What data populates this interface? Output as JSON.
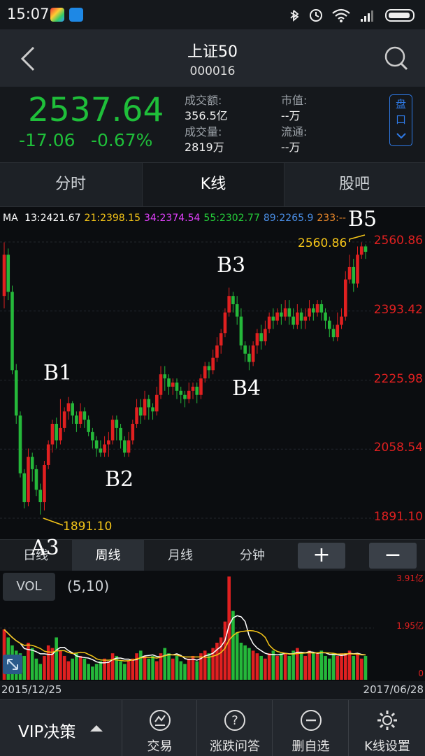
{
  "status_bar": {
    "time": "15:07",
    "battery_icon": "battery-icon",
    "wifi_icon": "wifi-icon"
  },
  "nav": {
    "title": "上证50",
    "code": "000016",
    "back_icon": "back-icon",
    "search_icon": "search-icon"
  },
  "quote": {
    "price": "2537.64",
    "change": "-17.06",
    "change_pct": "-0.67%",
    "turnover_label": "成交额:",
    "turnover_value": "356.5亿",
    "volume_label": "成交量:",
    "volume_value": "2819万",
    "market_cap_label": "市值:",
    "market_cap_value": "--万",
    "float_label": "流通:",
    "float_value": "--万",
    "pan_button": "盘\n口"
  },
  "tabs": [
    {
      "label": "分时"
    },
    {
      "label": "K线"
    },
    {
      "label": "股吧"
    }
  ],
  "ma": {
    "label": "MA",
    "items": [
      {
        "text": "13:2421.67",
        "color": "#ffffff"
      },
      {
        "text": "21:2398.15",
        "color": "#f5c518"
      },
      {
        "text": "34:2374.54",
        "color": "#e040fb"
      },
      {
        "text": "55:2302.77",
        "color": "#25d03a"
      },
      {
        "text": "89:2265.9",
        "color": "#4a8fe7"
      },
      {
        "text": "233:--",
        "color": "#e8872a"
      }
    ]
  },
  "chart_data": {
    "type": "candlestick",
    "y_ticks": [
      "2560.86",
      "2393.42",
      "2225.98",
      "2058.54",
      "1891.10"
    ],
    "ylim": [
      1891.1,
      2560.86
    ],
    "high_marker": "2560.86",
    "low_marker": "1891.10",
    "annotations": [
      "B1",
      "B2",
      "B3",
      "B4",
      "B5",
      "A3"
    ],
    "start_date": "2015/12/25",
    "end_date": "2017/06/28",
    "candles": [
      [
        2430,
        2530,
        2400,
        2560
      ],
      [
        2530,
        2440,
        2420,
        2545
      ],
      [
        2440,
        2250,
        2240,
        2455
      ],
      [
        2250,
        2140,
        2120,
        2265
      ],
      [
        2140,
        2000,
        1990,
        2150
      ],
      [
        2000,
        1930,
        1915,
        2010
      ],
      [
        1930,
        2040,
        1920,
        2060
      ],
      [
        2040,
        2010,
        1980,
        2050
      ],
      [
        2010,
        1960,
        1945,
        2020
      ],
      [
        1960,
        1930,
        1900,
        1975
      ],
      [
        1930,
        2020,
        1910,
        2030
      ],
      [
        2020,
        2070,
        2010,
        2080
      ],
      [
        2070,
        2120,
        2050,
        2130
      ],
      [
        2120,
        2080,
        2060,
        2135
      ],
      [
        2080,
        2110,
        2070,
        2180
      ],
      [
        2110,
        2150,
        2100,
        2160
      ],
      [
        2150,
        2170,
        2130,
        2185
      ],
      [
        2170,
        2140,
        2120,
        2175
      ],
      [
        2140,
        2120,
        2100,
        2150
      ],
      [
        2120,
        2150,
        2110,
        2170
      ],
      [
        2150,
        2130,
        2110,
        2160
      ],
      [
        2130,
        2100,
        2090,
        2140
      ],
      [
        2100,
        2080,
        2060,
        2110
      ],
      [
        2080,
        2060,
        2040,
        2090
      ],
      [
        2060,
        2050,
        2040,
        2080
      ],
      [
        2050,
        2070,
        2040,
        2090
      ],
      [
        2070,
        2080,
        2040,
        2100
      ],
      [
        2080,
        2130,
        2070,
        2140
      ],
      [
        2130,
        2110,
        2080,
        2140
      ],
      [
        2110,
        2080,
        2060,
        2120
      ],
      [
        2080,
        2050,
        2040,
        2090
      ],
      [
        2050,
        2080,
        2040,
        2100
      ],
      [
        2080,
        2120,
        2070,
        2130
      ],
      [
        2120,
        2160,
        2110,
        2180
      ],
      [
        2160,
        2140,
        2120,
        2180
      ],
      [
        2140,
        2180,
        2130,
        2200
      ],
      [
        2180,
        2160,
        2130,
        2190
      ],
      [
        2160,
        2150,
        2130,
        2170
      ],
      [
        2150,
        2190,
        2140,
        2210
      ],
      [
        2190,
        2240,
        2180,
        2260
      ],
      [
        2240,
        2230,
        2200,
        2260
      ],
      [
        2230,
        2210,
        2190,
        2240
      ],
      [
        2210,
        2220,
        2190,
        2230
      ],
      [
        2220,
        2200,
        2180,
        2230
      ],
      [
        2200,
        2190,
        2170,
        2210
      ],
      [
        2190,
        2180,
        2160,
        2200
      ],
      [
        2180,
        2200,
        2170,
        2220
      ],
      [
        2200,
        2210,
        2180,
        2220
      ],
      [
        2210,
        2190,
        2170,
        2220
      ],
      [
        2190,
        2230,
        2180,
        2240
      ],
      [
        2230,
        2260,
        2220,
        2270
      ],
      [
        2260,
        2250,
        2230,
        2270
      ],
      [
        2250,
        2280,
        2240,
        2300
      ],
      [
        2280,
        2310,
        2270,
        2330
      ],
      [
        2310,
        2340,
        2290,
        2350
      ],
      [
        2340,
        2390,
        2330,
        2400
      ],
      [
        2390,
        2430,
        2380,
        2450
      ],
      [
        2430,
        2410,
        2390,
        2440
      ],
      [
        2410,
        2380,
        2360,
        2430
      ],
      [
        2380,
        2310,
        2300,
        2400
      ],
      [
        2310,
        2290,
        2270,
        2320
      ],
      [
        2290,
        2270,
        2250,
        2310
      ],
      [
        2270,
        2310,
        2260,
        2320
      ],
      [
        2310,
        2340,
        2290,
        2350
      ],
      [
        2340,
        2320,
        2300,
        2360
      ],
      [
        2320,
        2350,
        2310,
        2370
      ],
      [
        2350,
        2380,
        2340,
        2390
      ],
      [
        2380,
        2370,
        2350,
        2400
      ],
      [
        2370,
        2390,
        2360,
        2400
      ],
      [
        2390,
        2380,
        2360,
        2410
      ],
      [
        2380,
        2400,
        2370,
        2420
      ],
      [
        2400,
        2380,
        2360,
        2420
      ],
      [
        2380,
        2360,
        2350,
        2400
      ],
      [
        2360,
        2390,
        2350,
        2410
      ],
      [
        2390,
        2370,
        2350,
        2400
      ],
      [
        2370,
        2380,
        2350,
        2400
      ],
      [
        2380,
        2400,
        2370,
        2420
      ],
      [
        2400,
        2390,
        2370,
        2410
      ],
      [
        2390,
        2410,
        2380,
        2420
      ],
      [
        2410,
        2390,
        2370,
        2420
      ],
      [
        2390,
        2370,
        2350,
        2400
      ],
      [
        2370,
        2350,
        2330,
        2380
      ],
      [
        2350,
        2330,
        2320,
        2360
      ],
      [
        2330,
        2360,
        2320,
        2390
      ],
      [
        2360,
        2380,
        2350,
        2400
      ],
      [
        2380,
        2470,
        2370,
        2490
      ],
      [
        2470,
        2500,
        2460,
        2530
      ],
      [
        2500,
        2460,
        2440,
        2520
      ],
      [
        2460,
        2530,
        2450,
        2550
      ],
      [
        2530,
        2550,
        2520,
        2560
      ],
      [
        2550,
        2537,
        2520,
        2555
      ]
    ]
  },
  "periods": [
    {
      "label": "日线"
    },
    {
      "label": "周线"
    },
    {
      "label": "月线"
    },
    {
      "label": "分钟"
    }
  ],
  "zoom": {
    "plus": "+",
    "minus": "−"
  },
  "volume": {
    "button": "VOL",
    "params": "(5,10)",
    "ticks": [
      "3.91亿",
      "1.95亿",
      "0"
    ],
    "unit_max": 3.91,
    "bars": [
      1.9,
      1.6,
      1.3,
      1.1,
      1.0,
      0.9,
      1.4,
      1.2,
      0.8,
      0.6,
      0.9,
      1.3,
      1.2,
      1.6,
      1.1,
      0.9,
      0.7,
      0.8,
      1.0,
      0.9,
      0.8,
      0.6,
      0.5,
      0.6,
      0.7,
      0.8,
      0.7,
      1.0,
      0.9,
      0.7,
      0.6,
      0.7,
      0.8,
      1.0,
      1.1,
      0.9,
      0.8,
      0.9,
      0.7,
      1.0,
      1.2,
      1.0,
      0.8,
      0.9,
      0.7,
      0.6,
      0.8,
      0.9,
      0.7,
      1.0,
      1.1,
      1.0,
      1.2,
      1.4,
      1.6,
      2.2,
      3.9,
      2.6,
      1.8,
      1.4,
      1.3,
      1.2,
      1.1,
      1.0,
      0.9,
      0.8,
      1.0,
      1.1,
      0.9,
      1.0,
      1.0,
      0.9,
      1.1,
      1.2,
      1.0,
      0.9,
      1.1,
      1.0,
      1.0,
      1.1,
      0.9,
      0.8,
      1.0,
      0.9,
      1.0,
      1.0,
      1.1,
      0.9,
      1.0,
      0.8,
      0.9
    ]
  },
  "dates": {
    "start": "2015/12/25",
    "end": "2017/06/28"
  },
  "bottom": {
    "vip": "VIP决策",
    "items": [
      {
        "label": "交易",
        "icon": "trade-icon"
      },
      {
        "label": "涨跌问答",
        "icon": "question-icon"
      },
      {
        "label": "删自选",
        "icon": "remove-watchlist-icon"
      },
      {
        "label": "K线设置",
        "icon": "gear-icon"
      }
    ]
  },
  "colors": {
    "up": "#e02020",
    "down": "#25b83a",
    "accent": "#2f7be8"
  }
}
